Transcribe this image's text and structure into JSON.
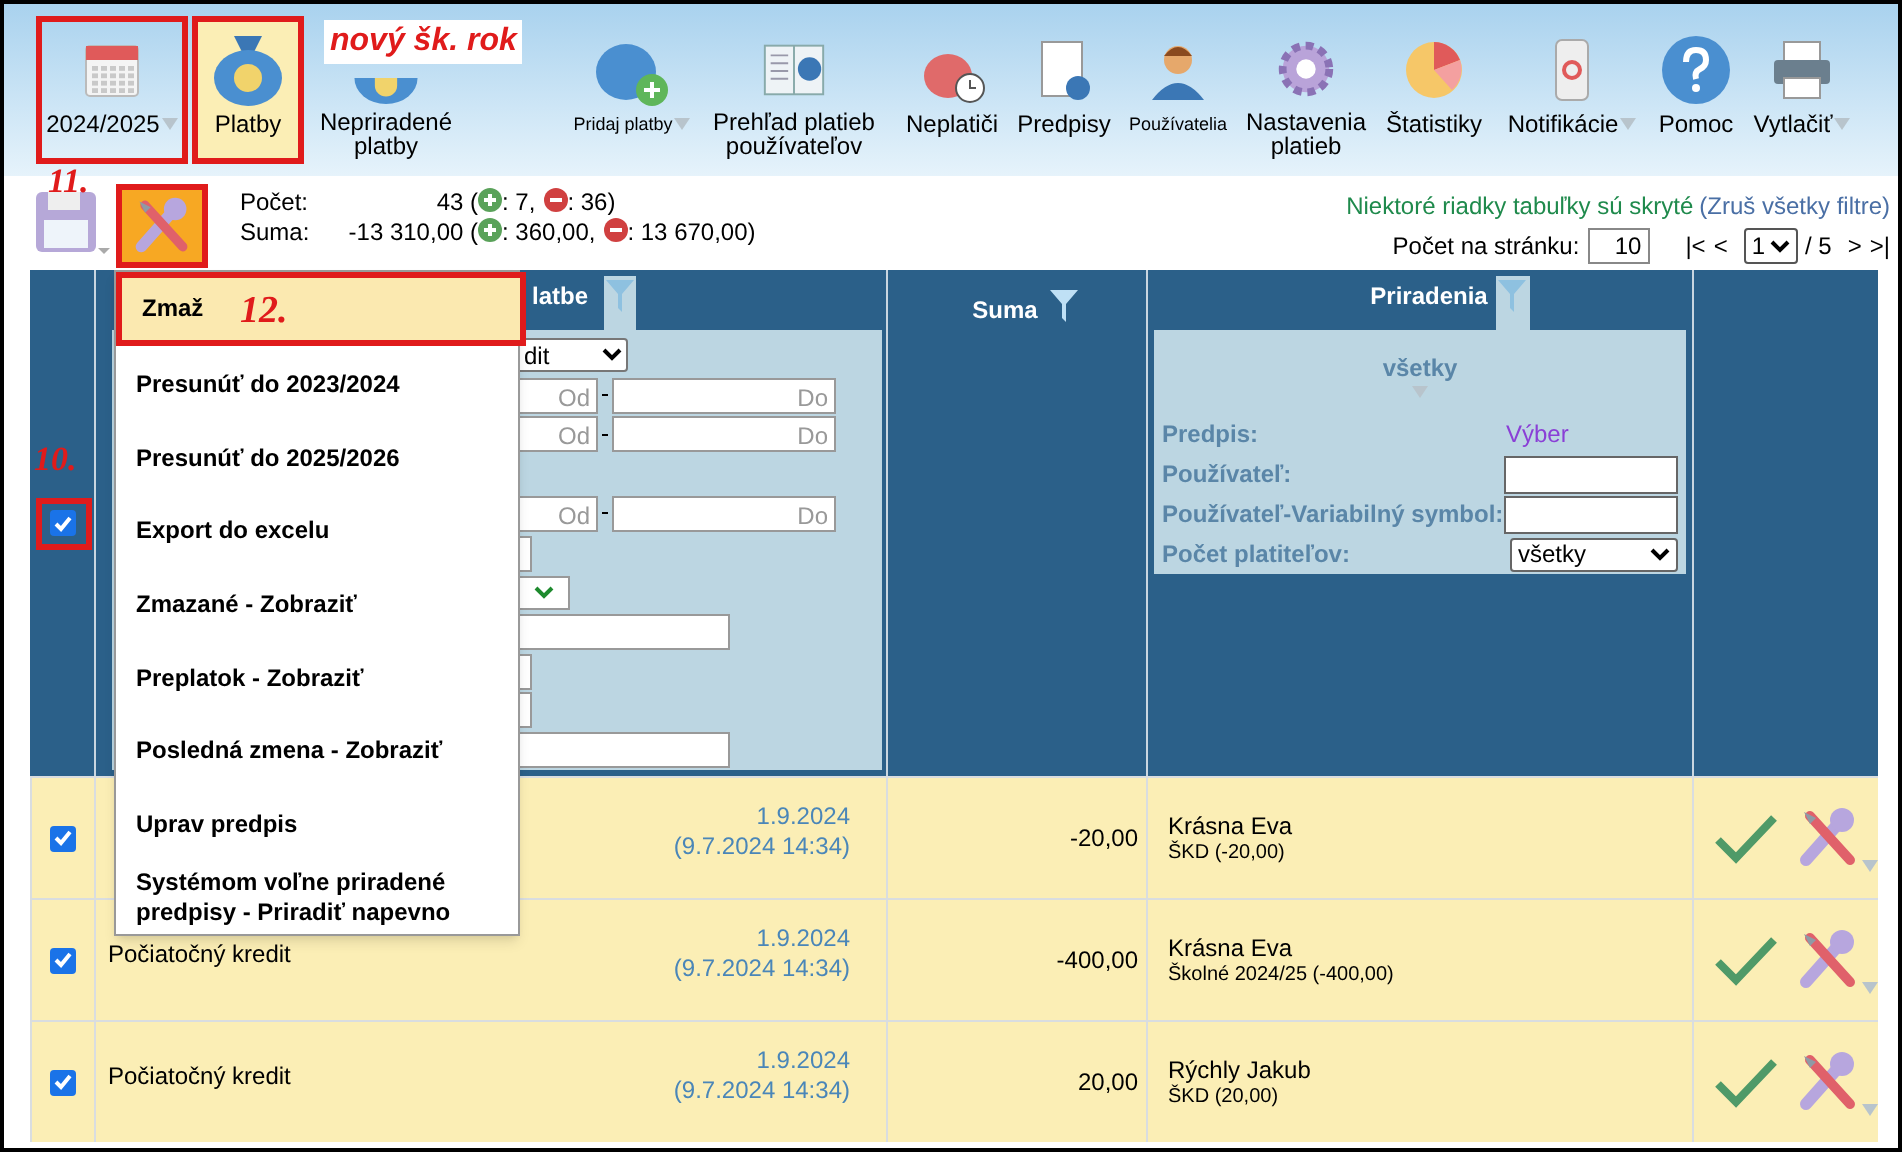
{
  "toolbar": [
    {
      "label": "2024/2025",
      "kind": "caret",
      "selected": false,
      "highlighted": true
    },
    {
      "label": "Platby",
      "kind": "plain",
      "selected": true,
      "highlighted": true
    },
    {
      "label": "Nepriradené platby",
      "kind": "plain",
      "selected": false,
      "highlighted": false
    },
    {
      "label": "Pridaj platby",
      "kind": "small-caret",
      "selected": false,
      "highlighted": false
    },
    {
      "label": "Prehľad platieb používateľov",
      "kind": "plain",
      "selected": false,
      "highlighted": false
    },
    {
      "label": "Neplatiči",
      "kind": "plain",
      "selected": false,
      "highlighted": false
    },
    {
      "label": "Predpisy",
      "kind": "plain",
      "selected": false,
      "highlighted": false
    },
    {
      "label": "Používatelia",
      "kind": "small",
      "selected": false,
      "highlighted": false
    },
    {
      "label": "Nastavenia platieb",
      "kind": "plain",
      "selected": false,
      "highlighted": false
    },
    {
      "label": "Štatistiky",
      "kind": "plain",
      "selected": false,
      "highlighted": false
    },
    {
      "label": "Notifikácie",
      "kind": "caret",
      "selected": false,
      "highlighted": false
    },
    {
      "label": "Pomoc",
      "kind": "plain",
      "selected": false,
      "highlighted": false
    },
    {
      "label": "Vytlačiť",
      "kind": "caret",
      "selected": false,
      "highlighted": false
    }
  ],
  "annotations": {
    "new_year": "nový šk. rok",
    "tools": "11.",
    "menu": "12.",
    "checkbox": "10."
  },
  "stats": {
    "count_label": "Počet:",
    "count": "43 (",
    "count_plus": ": 7,",
    "count_minus": ": 36)",
    "sum_label": "Suma:",
    "sum": "-13 310,00 (",
    "sum_plus": ": 360,00,",
    "sum_minus": ": 13 670,00)"
  },
  "notice": {
    "text": "Niektoré riadky tabuľky sú skryté",
    "link": "(Zruš všetky filtre)"
  },
  "paging": {
    "per_page_label": "Počet na stránku:",
    "per_page": "10",
    "first": "|<",
    "prev": "<",
    "page": "1",
    "total": "/ 5",
    "next": ">",
    "last": ">|"
  },
  "tools_button": {
    "highlighted": true
  },
  "menu": [
    {
      "label": "Zmaž",
      "selected": true
    },
    {
      "label": "Presunúť do 2023/2024",
      "selected": false
    },
    {
      "label": "Presunúť do 2025/2026",
      "selected": false
    },
    {
      "label": "Export do excelu",
      "selected": false
    },
    {
      "label": "Zmazané - Zobraziť",
      "selected": false
    },
    {
      "label": "Preplatok - Zobraziť",
      "selected": false
    },
    {
      "label": "Posledná zmena - Zobraziť",
      "selected": false
    },
    {
      "label": "Uprav predpis",
      "selected": false
    },
    {
      "label": "Systémom voľne priradené predpisy - Priradiť napevno",
      "selected": false
    }
  ],
  "header": {
    "select_all": {
      "checked": true,
      "highlighted": true
    },
    "column_2": "latbe",
    "suma": "Suma",
    "priradenia": "Priradenia"
  },
  "left_filter": [
    {
      "kind": "select",
      "value": "dit"
    },
    {
      "kind": "range",
      "from": "Od",
      "to": "Do"
    },
    {
      "kind": "range",
      "from": "Od",
      "to": "Do"
    },
    {
      "kind": "blank"
    },
    {
      "kind": "range",
      "from": "Od",
      "to": "Do"
    },
    {
      "kind": "sliver"
    },
    {
      "kind": "check-select"
    },
    {
      "kind": "input"
    },
    {
      "kind": "sliver"
    },
    {
      "kind": "sliver"
    },
    {
      "kind": "input"
    }
  ],
  "assign_filter": {
    "mode": "všetky",
    "predpis_label": "Predpis:",
    "predpis_link": "Výber",
    "user_label": "Používateľ:",
    "vs_label": "Používateľ-Variabilný symbol:",
    "payers_label": "Počet platiteľov:",
    "payers": "všetky"
  },
  "rows": [
    {
      "checked": true,
      "date": "1.9.2024",
      "created": "(9.7.2024 14:34)",
      "amount": "-20,00",
      "name": "Krásna Eva",
      "detail": "ŠKD (-20,00)"
    },
    {
      "checked": true,
      "description": "Počiatočný kredit",
      "date": "1.9.2024",
      "created": "(9.7.2024 14:34)",
      "amount": "-400,00",
      "name": "Krásna Eva",
      "detail": "Školné 2024/25 (-400,00)"
    },
    {
      "checked": true,
      "description": "Počiatočný kredit",
      "date": "1.9.2024",
      "created": "(9.7.2024 14:34)",
      "amount": "20,00",
      "name": "Rýchly Jakub",
      "detail": "ŠKD (20,00)"
    }
  ]
}
